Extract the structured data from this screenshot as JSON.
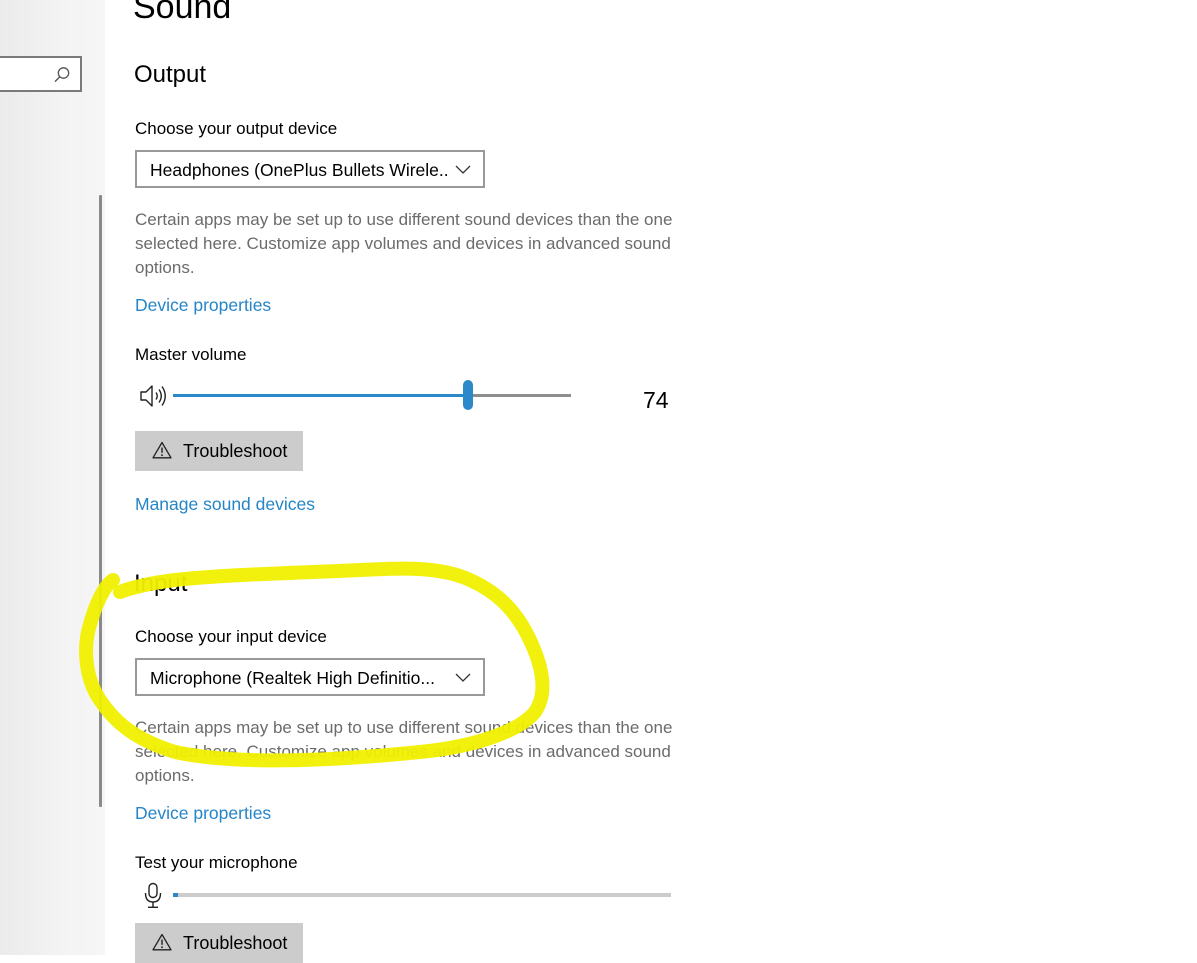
{
  "page": {
    "title": "Sound"
  },
  "sidebar": {
    "search": {
      "icon": "search-icon",
      "value": ""
    }
  },
  "output": {
    "heading": "Output",
    "choose_label": "Choose your output device",
    "device": "Headphones (OnePlus Bullets Wirele...",
    "description": "Certain apps may be set up to use different sound devices than the one selected here. Customize app volumes and devices in advanced sound options.",
    "device_properties_link": "Device properties",
    "master_volume_label": "Master volume",
    "volume_icon": "speaker-icon",
    "volume_value": "74",
    "volume_level": 74,
    "troubleshoot_label": "Troubleshoot",
    "troubleshoot_icon": "warning-icon",
    "manage_link": "Manage sound devices"
  },
  "input": {
    "heading": "Input",
    "choose_label": "Choose your input device",
    "device": "Microphone (Realtek High Definitio...",
    "description": "Certain apps may be set up to use different sound devices than the one selected here. Customize app volumes and devices in advanced sound options.",
    "device_properties_link": "Device properties",
    "test_label": "Test your microphone",
    "mic_icon": "microphone-icon",
    "mic_level": 1,
    "troubleshoot_label": "Troubleshoot",
    "troubleshoot_icon": "warning-icon"
  },
  "colors": {
    "accent": "#2b88c9",
    "link": "#2585c7",
    "highlight": "#f0f000"
  }
}
